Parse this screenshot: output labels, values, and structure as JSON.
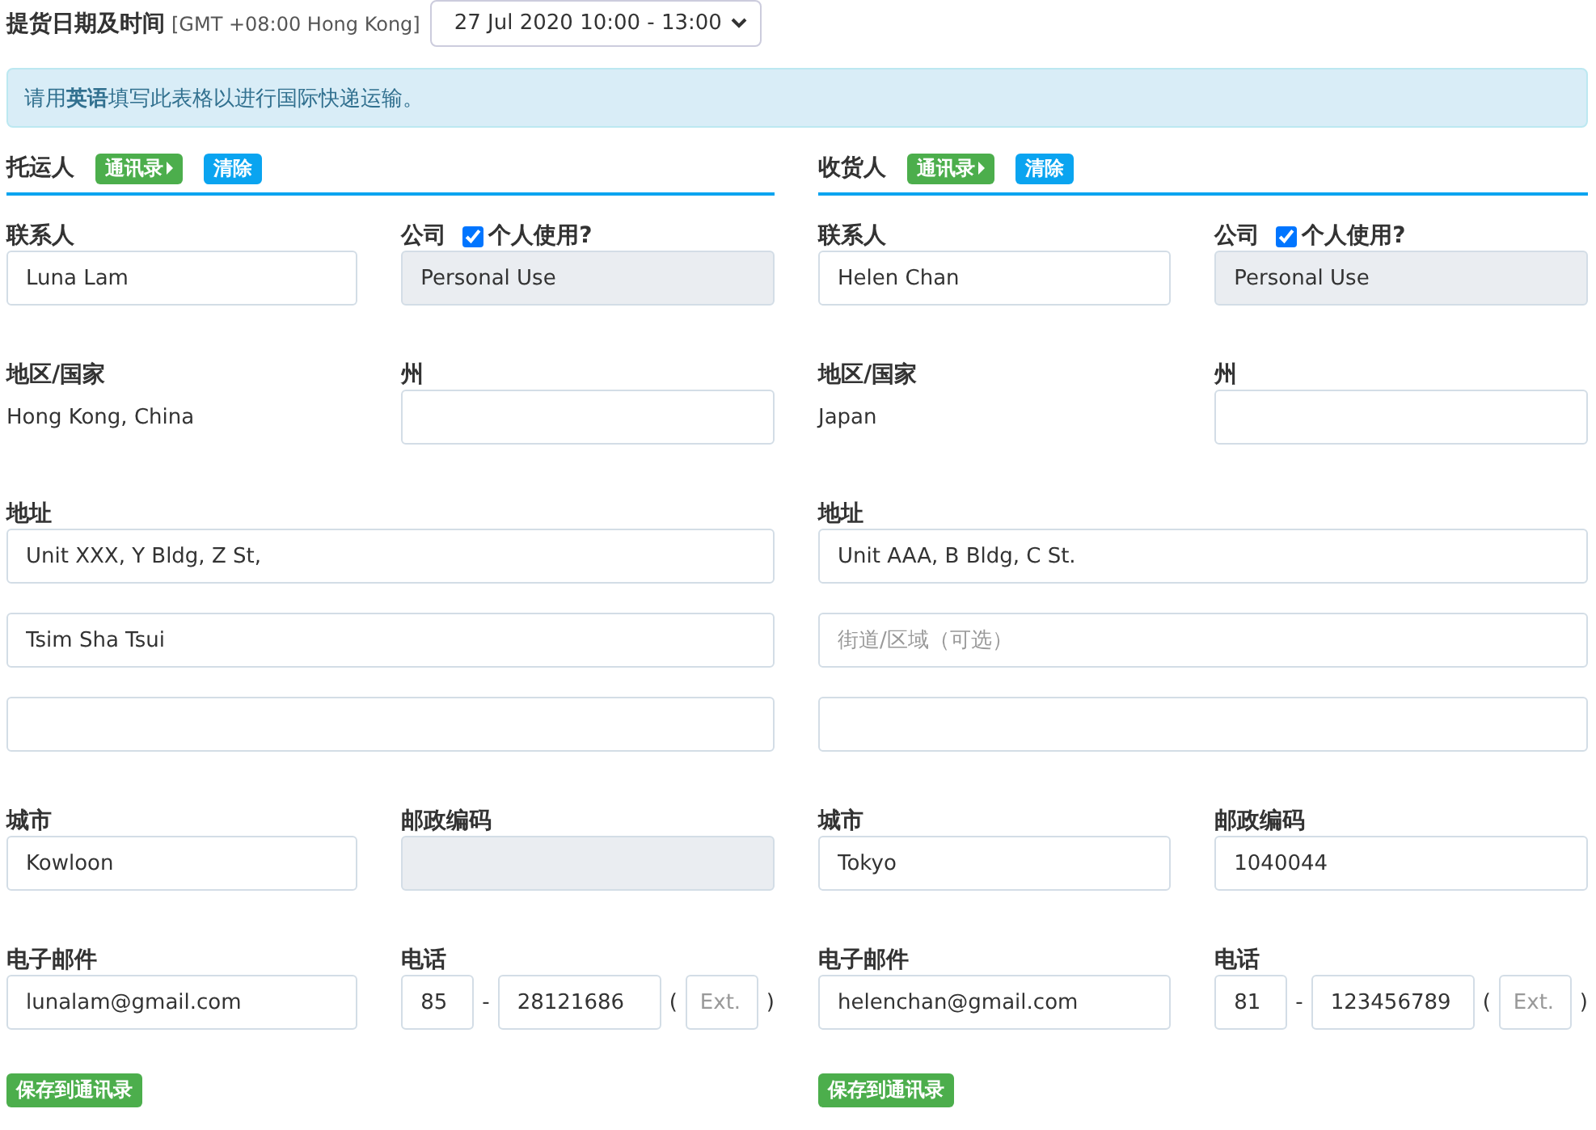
{
  "pickup": {
    "label": "提货日期及时间",
    "timezone": "[GMT +08:00 Hong Kong]",
    "value": "27 Jul 2020 10:00 - 13:00"
  },
  "notice": "请用**英语**填写此表格以进行国际快递运输。",
  "parties": [
    {
      "title": "托运人",
      "address_book_button": "通讯录",
      "clear_button": "清除",
      "contact": {
        "label": "联系人",
        "value": "Luna Lam"
      },
      "company": {
        "label": "公司",
        "personal_use_label": "个人使用?",
        "personal_use_checked": true,
        "value": "Personal Use"
      },
      "region": {
        "label": "地区/国家",
        "value": "Hong Kong, China"
      },
      "state": {
        "label": "州"
      },
      "address": {
        "label": "地址",
        "lines": [
          {
            "kind": "filled",
            "value": "Unit XXX, Y Bldg, Z St,"
          },
          {
            "kind": "filled",
            "value": "Tsim Sha Tsui"
          },
          {
            "kind": "empty"
          }
        ]
      },
      "city": {
        "label": "城市",
        "value": "Kowloon"
      },
      "postal": {
        "label": "邮政编码",
        "disabled": true
      },
      "email": {
        "label": "电子邮件",
        "value": "lunalam@gmail.com"
      },
      "phone": {
        "label": "电话",
        "country_code": "85",
        "dash": "-",
        "number": "28121686",
        "open_paren": "(",
        "ext_placeholder": "Ext.",
        "close_paren": ")"
      },
      "save_button": "保存到通讯录"
    },
    {
      "title": "收货人",
      "address_book_button": "通讯录",
      "clear_button": "清除",
      "contact": {
        "label": "联系人",
        "value": "Helen Chan"
      },
      "company": {
        "label": "公司",
        "personal_use_label": "个人使用?",
        "personal_use_checked": true,
        "value": "Personal Use"
      },
      "region": {
        "label": "地区/国家",
        "value": "Japan"
      },
      "state": {
        "label": "州"
      },
      "address": {
        "label": "地址",
        "lines": [
          {
            "kind": "filled",
            "value": "Unit AAA, B Bldg, C St."
          },
          {
            "kind": "hint",
            "placeholder": "街道/区域（可选）"
          },
          {
            "kind": "empty"
          }
        ]
      },
      "city": {
        "label": "城市",
        "value": "Tokyo"
      },
      "postal": {
        "label": "邮政编码",
        "value": "1040044",
        "disabled": false
      },
      "email": {
        "label": "电子邮件",
        "value": "helenchan@gmail.com"
      },
      "phone": {
        "label": "电话",
        "country_code": "81",
        "dash": "-",
        "number": "123456789",
        "open_paren": "(",
        "ext_placeholder": "Ext.",
        "close_paren": ")"
      },
      "save_button": "保存到通讯录"
    }
  ]
}
